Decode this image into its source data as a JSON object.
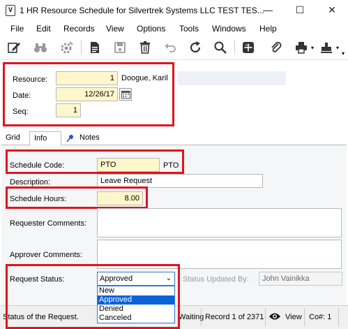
{
  "window": {
    "icon_text": "V",
    "title": "1 HR Resource Schedule for Silvertrek Systems LLC TEST TES...",
    "minimize": "—",
    "maximize": "☐",
    "close": "✕"
  },
  "menu": [
    "File",
    "Edit",
    "Records",
    "View",
    "Options",
    "Tools",
    "Windows",
    "Help"
  ],
  "toolbar_icons": [
    "edit-icon",
    "binoculars-icon",
    "gear-icon",
    "document-icon",
    "save-icon",
    "trash-icon",
    "undo-icon",
    "refresh-icon",
    "search-icon",
    "calculator-icon",
    "paperclip-icon",
    "print-icon"
  ],
  "header": {
    "resource_label": "Resource:",
    "resource_value": "1",
    "resource_name": "Doogue, Karil",
    "date_label": "Date:",
    "date_value": "12/26/17",
    "seq_label": "Seq:",
    "seq_value": "1"
  },
  "tabs": [
    "Grid",
    "Info",
    "Notes"
  ],
  "info": {
    "schedule_code_label": "Schedule Code:",
    "schedule_code_value": "PTO",
    "schedule_code_desc": "PTO",
    "description_label": "Description:",
    "description_value": "Leave Request",
    "schedule_hours_label": "Schedule Hours:",
    "schedule_hours_value": "8.00",
    "requester_comments_label": "Requester Comments:",
    "approver_comments_label": "Approver Comments:",
    "request_status_label": "Request Status:",
    "request_status_value": "Approved",
    "request_status_options": [
      "New",
      "Approved",
      "Denied",
      "Canceled"
    ],
    "status_updated_by_label": "Status Updated By:",
    "status_updated_by_value": "John Vainikka"
  },
  "statusbar": {
    "hint": "Status of the Request.",
    "waiting": "Waiting",
    "record": "Record 1 of 2371",
    "view": "View",
    "co": "Co#: 1"
  },
  "colors": {
    "highlight": "#e0141e",
    "required_field": "#fff7cc",
    "selection": "#0a64d8"
  }
}
